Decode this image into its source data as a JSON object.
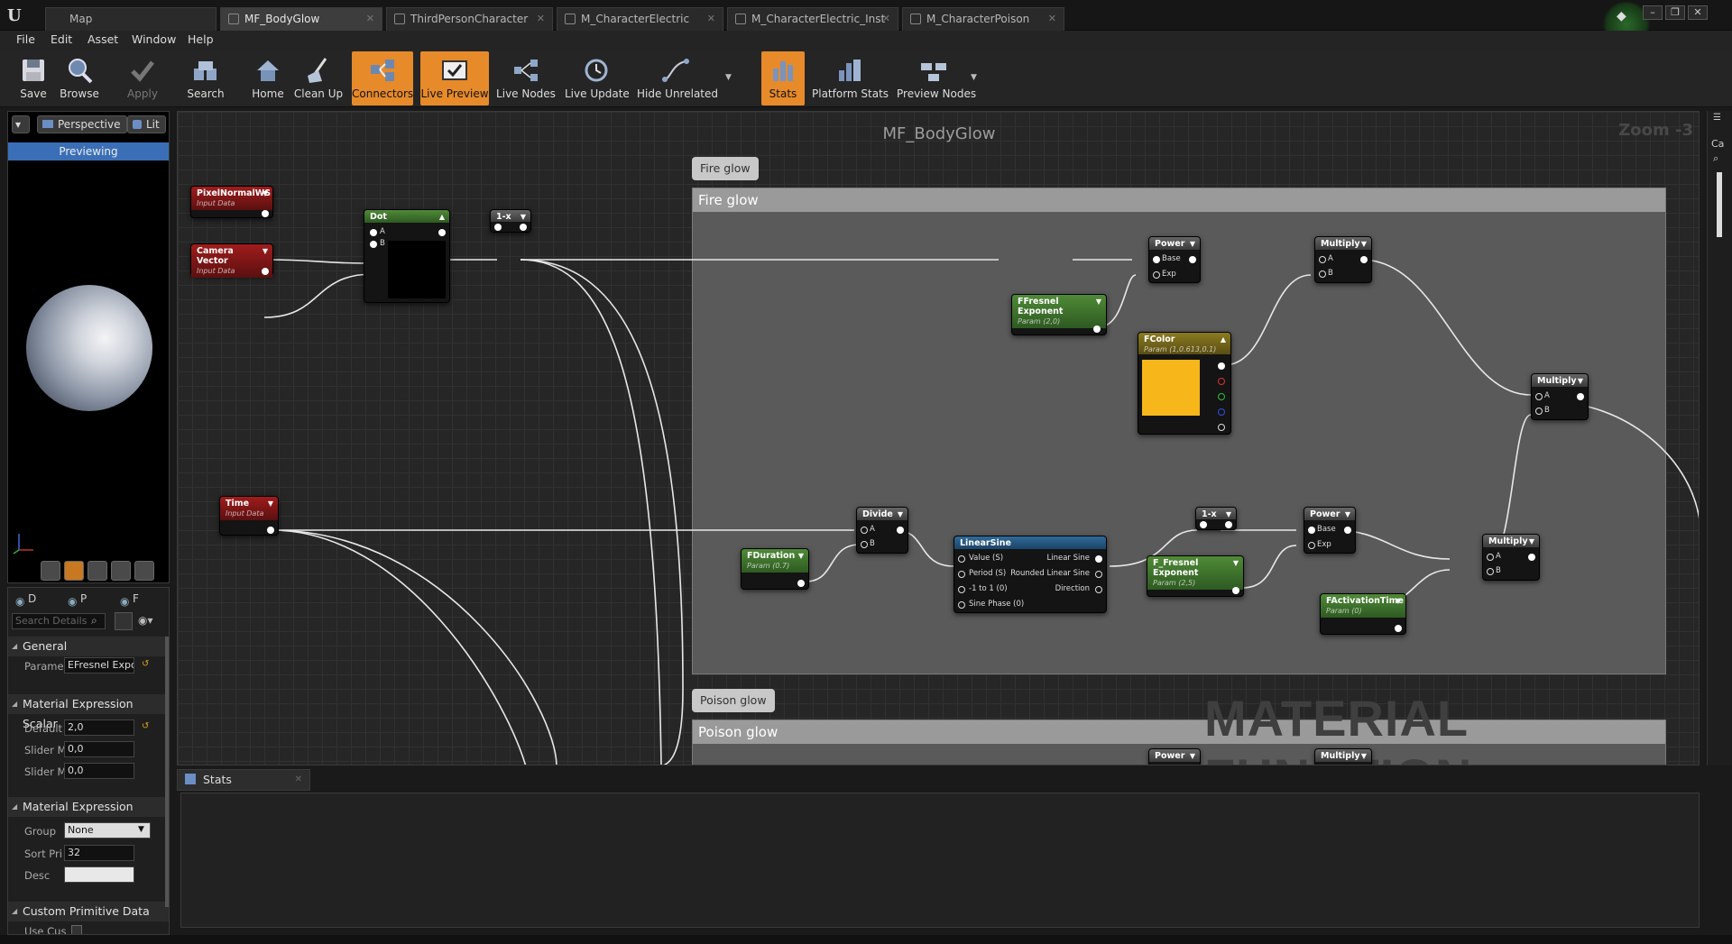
{
  "tabs": [
    {
      "label": "Map",
      "active": false
    },
    {
      "label": "MF_BodyGlow",
      "active": true
    },
    {
      "label": "ThirdPersonCharacter",
      "active": false
    },
    {
      "label": "M_CharacterElectric",
      "active": false
    },
    {
      "label": "M_CharacterElectric_Inst",
      "active": false
    },
    {
      "label": "M_CharacterPoison",
      "active": false
    }
  ],
  "menu": [
    "File",
    "Edit",
    "Asset",
    "Window",
    "Help"
  ],
  "toolbar": [
    {
      "label": "Save",
      "icon": "save-icon",
      "state": "normal"
    },
    {
      "label": "Browse",
      "icon": "browse-icon",
      "state": "normal"
    },
    {
      "label": "Apply",
      "icon": "apply-icon",
      "state": "disabled"
    },
    {
      "label": "Search",
      "icon": "search-icon",
      "state": "normal"
    },
    {
      "label": "Home",
      "icon": "home-icon",
      "state": "normal"
    },
    {
      "label": "Clean Up",
      "icon": "cleanup-icon",
      "state": "normal"
    },
    {
      "label": "Connectors",
      "icon": "connectors-icon",
      "state": "active"
    },
    {
      "label": "Live Preview",
      "icon": "live-preview-icon",
      "state": "active"
    },
    {
      "label": "Live Nodes",
      "icon": "live-nodes-icon",
      "state": "normal"
    },
    {
      "label": "Live Update",
      "icon": "live-update-icon",
      "state": "normal"
    },
    {
      "label": "Hide Unrelated",
      "icon": "hide-unrelated-icon",
      "state": "normal"
    },
    {
      "label": "Stats",
      "icon": "stats-icon",
      "state": "active"
    },
    {
      "label": "Platform Stats",
      "icon": "platform-stats-icon",
      "state": "normal"
    },
    {
      "label": "Preview Nodes",
      "icon": "preview-nodes-icon",
      "state": "normal"
    }
  ],
  "viewport": {
    "perspective": "Perspective",
    "lit": "Lit",
    "previewing": "Previewing"
  },
  "details": {
    "tabs": [
      "D",
      "P",
      "F"
    ],
    "search_placeholder": "Search Details",
    "general": "General",
    "param_label": "Parame",
    "param_value": "EFresnel Expo",
    "scalar_cat": "Material Expression Scalar",
    "default_label": "Default",
    "default_value": "2,0",
    "slider_min_label": "Slider M",
    "slider_min_value": "0,0",
    "slider_max_label": "Slider M",
    "slider_max_value": "0,0",
    "expr_cat": "Material Expression",
    "group_label": "Group",
    "group_value": "None",
    "sort_label": "Sort Pri",
    "sort_value": "32",
    "desc_label": "Desc",
    "custom_cat": "Custom Primitive Data",
    "use_label": "Use Cus"
  },
  "graph": {
    "title": "MF_BodyGlow",
    "zoom": "Zoom -3",
    "watermark": "MATERIAL FUNCTION",
    "fire_bubble": "Fire glow",
    "fire_header": "Fire glow",
    "poison_bubble": "Poison glow",
    "poison_header": "Poison glow"
  },
  "nodes": {
    "pixelnormal": {
      "title": "PixelNormalWS",
      "sub": "Input Data"
    },
    "camvec": {
      "title": "Camera Vector",
      "sub": "Input Data"
    },
    "dot": {
      "title": "Dot",
      "a": "A",
      "b": "B"
    },
    "oneminus1": {
      "title": "1-x"
    },
    "power1": {
      "title": "Power",
      "base": "Base",
      "exp": "Exp"
    },
    "multiply1": {
      "title": "Multiply",
      "a": "A",
      "b": "B"
    },
    "ffresnel": {
      "title": "FFresnel Exponent",
      "sub": "Param (2,0)"
    },
    "fcolor": {
      "title": "FColor",
      "sub": "Param (1,0.613,0.1)",
      "swatch": "#f7b71a"
    },
    "multiply_out": {
      "title": "Multiply",
      "a": "A",
      "b": "B"
    },
    "time": {
      "title": "Time",
      "sub": "Input Data"
    },
    "divide": {
      "title": "Divide",
      "a": "A",
      "b": "B"
    },
    "fduration": {
      "title": "FDuration",
      "sub": "Param (0.7)"
    },
    "linearsine": {
      "title": "LinearSine",
      "in1": "Value (S)",
      "in2": "Period (S)",
      "in3": "-1 to 1 (0)",
      "in4": "Sine Phase (0)",
      "out1": "Linear Sine",
      "out2": "Rounded Linear Sine",
      "out3": "Direction"
    },
    "oneminus2": {
      "title": "1-x"
    },
    "power2": {
      "title": "Power",
      "base": "Base",
      "exp": "Exp"
    },
    "ffresnel2": {
      "title": "F_Fresnel Exponent",
      "sub": "Param (2,5)"
    },
    "factivation": {
      "title": "FActivationTime",
      "sub": "Param (0)"
    },
    "multiply2": {
      "title": "Multiply",
      "a": "A",
      "b": "B"
    },
    "power3": {
      "title": "Power"
    },
    "multiply3": {
      "title": "Multiply"
    }
  },
  "stats_tab": "Stats",
  "right_panel": "Ca"
}
